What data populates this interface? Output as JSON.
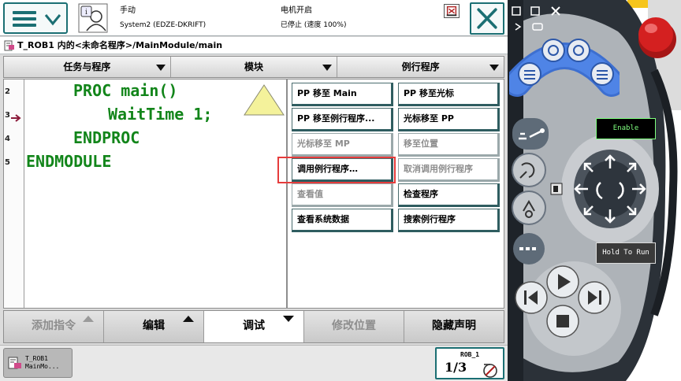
{
  "status": {
    "mode": "手动",
    "system": "System2 (EDZE-DKRIFT)",
    "motors": "电机开启",
    "state": "已停止 (速度 100%)"
  },
  "path": "T_ROB1 内的<未命名程序>/MainModule/main",
  "menu": {
    "tasks": "任务与程序",
    "modules": "模块",
    "routines": "例行程序"
  },
  "editor": {
    "lines": [
      {
        "num": "2",
        "code": "PROC main()"
      },
      {
        "num": "3",
        "code": "WaitTime 1;"
      },
      {
        "num": "4",
        "code": "ENDPROC"
      },
      {
        "num": "5",
        "code": "ENDMODULE"
      }
    ]
  },
  "actions": {
    "pp_to_main": "PP 移至 Main",
    "pp_to_cursor": "PP 移至光标",
    "pp_to_routine": "PP 移至例行程序...",
    "cursor_to_pp": "光标移至 PP",
    "cursor_to_mp": "光标移至 MP",
    "go_to_position": "移至位置",
    "call_routine": "调用例行程序…",
    "cancel_call_routine": "取消调用例行程序",
    "view_value": "查看值",
    "check_program": "检查程序",
    "view_system_data": "查看系统数据",
    "search_routine": "搜索例行程序"
  },
  "bottom": {
    "add_instruction": "添加指令",
    "edit": "编辑",
    "debug": "调试",
    "modify_position": "修改位置",
    "hide_declarations": "隐藏声明"
  },
  "taskbar": {
    "task_line1": "T_ROB1",
    "task_line2": "MainMo...",
    "robot": "ROB_1",
    "speed": "1/3"
  },
  "device": {
    "enable": "Enable",
    "hold_to_run": "Hold To Run"
  },
  "colors": {
    "code_green": "#12851a",
    "teal_border": "#1b6f73",
    "highlight_red": "#e63c3c",
    "pendant_blue": "#3d6fd0",
    "estop_red": "#d42020",
    "device_yellow": "#f6c51c"
  }
}
